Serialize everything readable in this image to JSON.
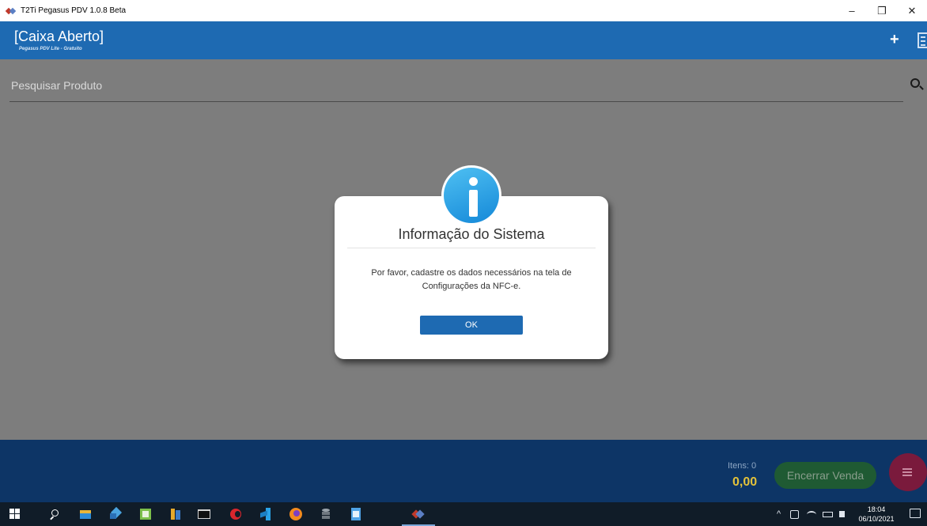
{
  "window": {
    "title": "T2Ti Pegasus PDV 1.0.8 Beta",
    "minimize": "–",
    "restore": "❐",
    "close": "✕"
  },
  "header": {
    "title": "[Caixa Aberto]",
    "subtitle": "Pegasus PDV Lite - Gratuito",
    "add_icon": "+"
  },
  "search": {
    "placeholder": "Pesquisar Produto"
  },
  "dialog": {
    "title": "Informação do Sistema",
    "message_line1": "Por favor, cadastre os dados necessários na tela de",
    "message_line2": "Configurações da NFC-e.",
    "ok_label": "OK",
    "icon": "info-icon"
  },
  "footer": {
    "itens_label": "Itens: 0",
    "total": "0,00",
    "encerrar_label": "Encerrar Venda"
  },
  "taskbar": {
    "time": "18:04",
    "date": "06/10/2021",
    "tray_arrow": "^"
  },
  "colors": {
    "header_bg": "#1e6ab2",
    "footer_bg": "#0d3566",
    "button_green": "#1f5a33",
    "fab": "#7a1a3c",
    "total": "#e3c23a"
  }
}
